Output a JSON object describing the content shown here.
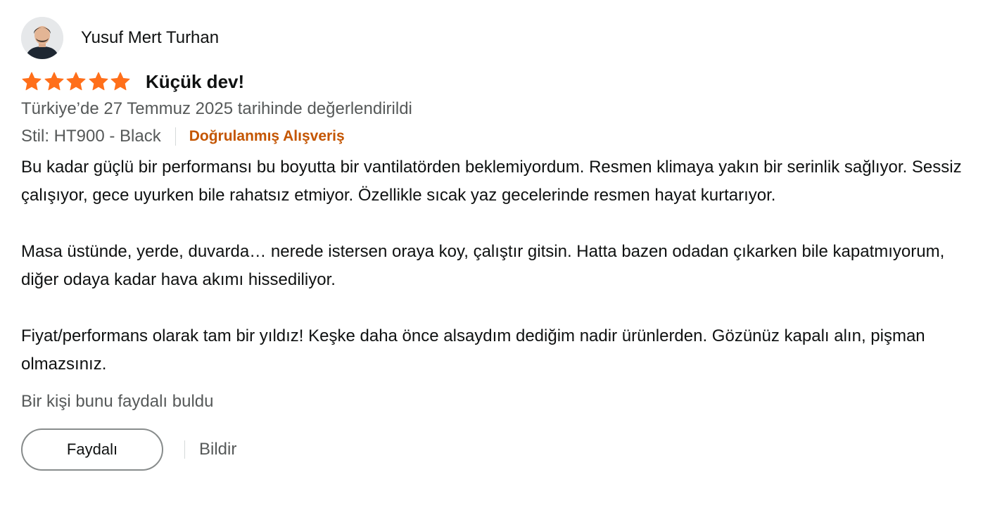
{
  "profile": {
    "name": "Yusuf Mert Turhan"
  },
  "review": {
    "rating": 5,
    "rating_max": 5,
    "title": "Küçük dev!",
    "date": "Türkiye’de 27 Temmuz 2025 tarihinde değerlendirildi",
    "style": "Stil: HT900 - Black",
    "verified": "Doğrulanmış Alışveriş",
    "body": [
      "Bu kadar güçlü bir performansı bu boyutta bir vantilatörden beklemiyordum. Resmen klimaya yakın bir serinlik sağlıyor. Sessiz çalışıyor, gece uyurken bile rahatsız etmiyor. Özellikle sıcak yaz gecelerinde resmen hayat kurtarıyor.",
      "Masa üstünde, yerde, duvarda… nerede istersen oraya koy, çalıştır gitsin. Hatta bazen odadan çıkarken bile kapatmıyorum, diğer odaya kadar hava akımı hissediliyor.",
      "Fiyat/performans olarak tam bir yıldız! Keşke daha önce alsaydım dediğim nadir ürünlerden. Gözünüz kapalı alın, pişman olmazsınız."
    ],
    "helpful_count": "Bir kişi bunu faydalı buldu"
  },
  "actions": {
    "helpful_label": "Faydalı",
    "report_label": "Bildir"
  },
  "icons": {
    "avatar": "avatar-icon",
    "star": "star-icon"
  },
  "colors": {
    "star": "#ff6f1a",
    "verified": "#c45500",
    "secondary_text": "#565959",
    "primary_text": "#0f1111"
  }
}
